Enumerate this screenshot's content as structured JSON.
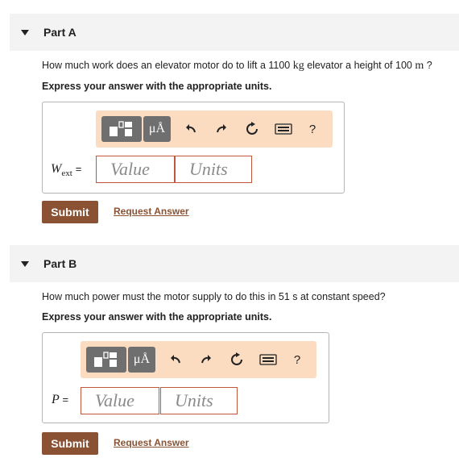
{
  "parts": [
    {
      "title": "Part A",
      "question_pre": "How much work does an elevator motor do to lift a 1100 ",
      "unit1": "kg",
      "question_mid": " elevator a height of 100 ",
      "unit2": "m",
      "question_post": " ?",
      "instruction": "Express your answer with the appropriate units.",
      "variable": "W",
      "variable_sub": "ext",
      "equals": "=",
      "value_placeholder": "Value",
      "units_placeholder": "Units",
      "submit_label": "Submit",
      "request_label": "Request Answer"
    },
    {
      "title": "Part B",
      "question": "How much power must the motor supply to do this in 51 s at constant speed?",
      "instruction": "Express your answer with the appropriate units.",
      "variable": "P",
      "equals": "=",
      "value_placeholder": "Value",
      "units_placeholder": "Units",
      "submit_label": "Submit",
      "request_label": "Request Answer"
    }
  ],
  "toolbar": {
    "templates_icon": "templates-icon",
    "symbols_label": "μÅ",
    "undo_icon": "undo-icon",
    "redo_icon": "redo-icon",
    "reset_icon": "reset-icon",
    "keyboard_icon": "keyboard-icon",
    "help_label": "?"
  },
  "colors": {
    "toolbar_bg": "#fbdcc0",
    "submit_bg": "#8a5233",
    "link": "#8a5233",
    "field_border": "#c0563a",
    "header_bg": "#f3f3f3"
  }
}
